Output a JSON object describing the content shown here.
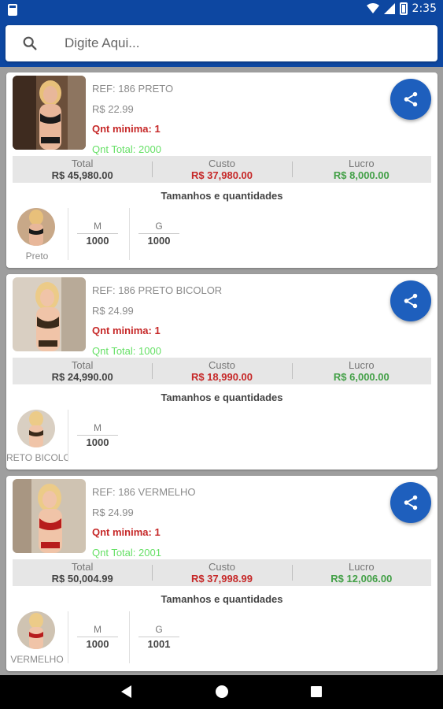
{
  "status": {
    "time": "2:35"
  },
  "search": {
    "placeholder": "Digite Aqui..."
  },
  "products": [
    {
      "ref": "REF: 186 PRETO",
      "price": "R$ 22.99",
      "qnt_min": "Qnt minima: 1",
      "qnt_total": "Qnt Total: 2000",
      "total_label": "Total",
      "total": "R$ 45,980.00",
      "custo_label": "Custo",
      "custo": "R$ 37,980.00",
      "lucro_label": "Lucro",
      "lucro": "R$ 8,000.00",
      "sizes_title": "Tamanhos e quantidades",
      "color": "Preto",
      "sizes": [
        {
          "size": "M",
          "qty": "1000"
        },
        {
          "size": "G",
          "qty": "1000"
        }
      ],
      "garment_color": "#1a1a1a"
    },
    {
      "ref": "REF: 186 PRETO BICOLOR",
      "price": "R$ 24.99",
      "qnt_min": "Qnt minima: 1",
      "qnt_total": "Qnt Total: 1000",
      "total_label": "Total",
      "total": "R$ 24,990.00",
      "custo_label": "Custo",
      "custo": "R$ 18,990.00",
      "lucro_label": "Lucro",
      "lucro": "R$ 6,000.00",
      "sizes_title": "Tamanhos e quantidades",
      "color": "RETO BICOLO",
      "sizes": [
        {
          "size": "M",
          "qty": "1000"
        }
      ],
      "garment_color": "#3a2a1a"
    },
    {
      "ref": "REF: 186 VERMELHO",
      "price": "R$ 24.99",
      "qnt_min": "Qnt minima: 1",
      "qnt_total": "Qnt Total: 2001",
      "total_label": "Total",
      "total": "R$ 50,004.99",
      "custo_label": "Custo",
      "custo": "R$ 37,998.99",
      "lucro_label": "Lucro",
      "lucro": "R$ 12,006.00",
      "sizes_title": "Tamanhos e quantidades",
      "color": "VERMELHO",
      "sizes": [
        {
          "size": "M",
          "qty": "1000"
        },
        {
          "size": "G",
          "qty": "1001"
        }
      ],
      "garment_color": "#b71c1c"
    }
  ],
  "colors": {
    "primary": "#0d47a1",
    "share_button": "#1e5fbd",
    "red": "#c62828",
    "green": "#43a047",
    "qnt_total": "#66e066"
  }
}
